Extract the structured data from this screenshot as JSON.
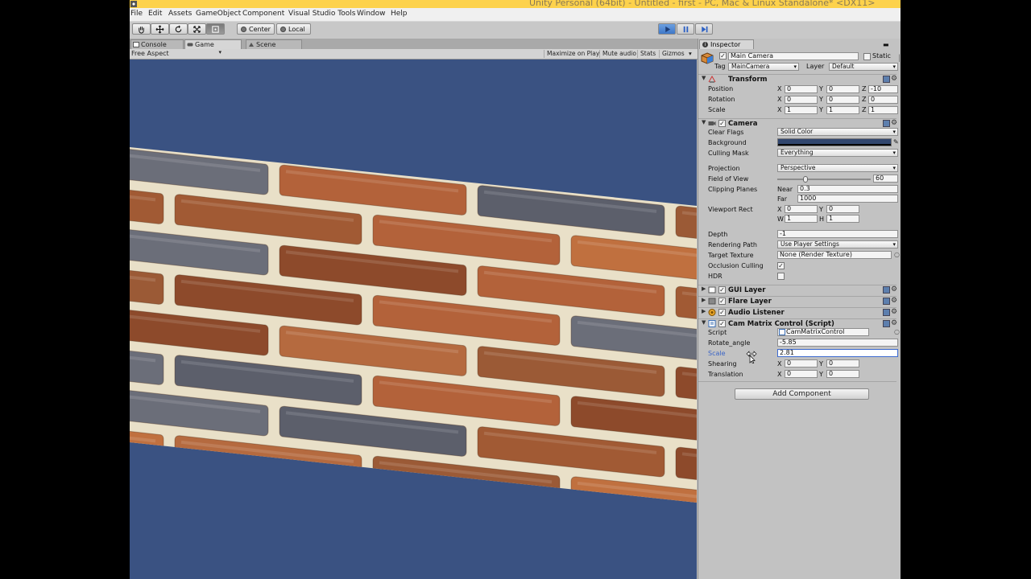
{
  "window": {
    "title": "Unity Personal (64bit) - Untitled - first - PC, Mac & Linux Standalone* <DX11>"
  },
  "menu": [
    "File",
    "Edit",
    "Assets",
    "GameObject",
    "Component",
    "Visual Studio Tools",
    "Window",
    "Help"
  ],
  "toolbar": {
    "pivot_label": "Center",
    "space_label": "Local"
  },
  "tabs": {
    "console": "Console",
    "game": "Game",
    "scene": "Scene"
  },
  "gamebar": {
    "aspect": "Free Aspect",
    "maximize": "Maximize on Play",
    "mute": "Mute audio",
    "stats": "Stats",
    "gizmos": "Gizmos"
  },
  "inspector": {
    "tab_label": "Inspector",
    "object_name": "Main Camera",
    "static_label": "Static",
    "tag_label": "Tag",
    "tag_value": "MainCamera",
    "layer_label": "Layer",
    "layer_value": "Default",
    "transform": {
      "title": "Transform",
      "position_label": "Position",
      "rotation_label": "Rotation",
      "scale_label": "Scale",
      "position": {
        "x": "0",
        "y": "0",
        "z": "-10"
      },
      "rotation": {
        "x": "0",
        "y": "0",
        "z": "0"
      },
      "scale": {
        "x": "1",
        "y": "1",
        "z": "1"
      }
    },
    "camera": {
      "title": "Camera",
      "clear_flags_label": "Clear Flags",
      "clear_flags": "Solid Color",
      "background_label": "Background",
      "background_color": "#31466e",
      "culling_label": "Culling Mask",
      "culling": "Everything",
      "projection_label": "Projection",
      "projection": "Perspective",
      "fov_label": "Field of View",
      "fov": "60",
      "fov_fraction": 0.3,
      "clipping_label": "Clipping Planes",
      "near_label": "Near",
      "near": "0.3",
      "far_label": "Far",
      "far": "1000",
      "viewport_label": "Viewport Rect",
      "vp": {
        "x": "0",
        "y": "0",
        "w": "1",
        "h": "1"
      },
      "depth_label": "Depth",
      "depth": "-1",
      "rendering_label": "Rendering Path",
      "rendering": "Use Player Settings",
      "target_label": "Target Texture",
      "target": "None (Render Texture)",
      "occlusion_label": "Occlusion Culling",
      "hdr_label": "HDR"
    },
    "gui_layer": "GUI Layer",
    "flare_layer": "Flare Layer",
    "audio_listener": "Audio Listener",
    "script_comp": {
      "title": "Cam Matrix Control (Script)",
      "script_label": "Script",
      "script_value": "CamMatrixControl",
      "rotate_label": "Rotate_angle",
      "rotate_value": "-5.85",
      "scale_label": "Scale",
      "scale_value": "2.81",
      "shearing_label": "Shearing",
      "shearing": {
        "x": "0",
        "y": "0"
      },
      "translation_label": "Translation",
      "translation": {
        "x": "0",
        "y": "0"
      }
    },
    "add_component": "Add Component"
  }
}
